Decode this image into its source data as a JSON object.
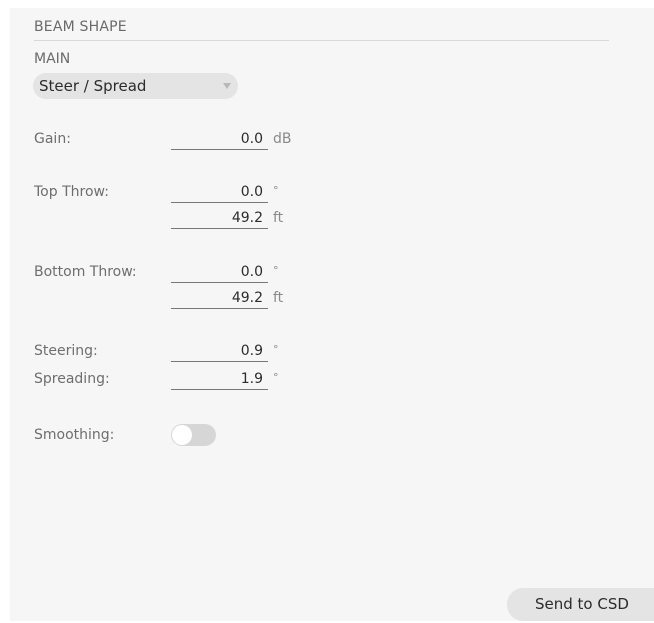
{
  "panel": {
    "title": "BEAM SHAPE",
    "group_label": "MAIN",
    "mode_select": {
      "selected": "Steer / Spread"
    }
  },
  "gain": {
    "label": "Gain:",
    "value": "0.0",
    "unit": "dB"
  },
  "top_throw": {
    "label": "Top Throw:",
    "angle": "0.0",
    "angle_unit": "°",
    "distance": "49.2",
    "distance_unit": "ft"
  },
  "bottom_throw": {
    "label": "Bottom Throw:",
    "angle": "0.0",
    "angle_unit": "°",
    "distance": "49.2",
    "distance_unit": "ft"
  },
  "steering": {
    "label": "Steering:",
    "value": "0.9",
    "unit": "°"
  },
  "spreading": {
    "label": "Spreading:",
    "value": "1.9",
    "unit": "°"
  },
  "smoothing": {
    "label": "Smoothing:",
    "enabled": false
  },
  "actions": {
    "send_label": "Send to CSD"
  },
  "colors": {
    "panel_bg": "#f6f6f6",
    "control_bg": "#e4e4e4",
    "toggle_off": "#d6d6d6"
  }
}
